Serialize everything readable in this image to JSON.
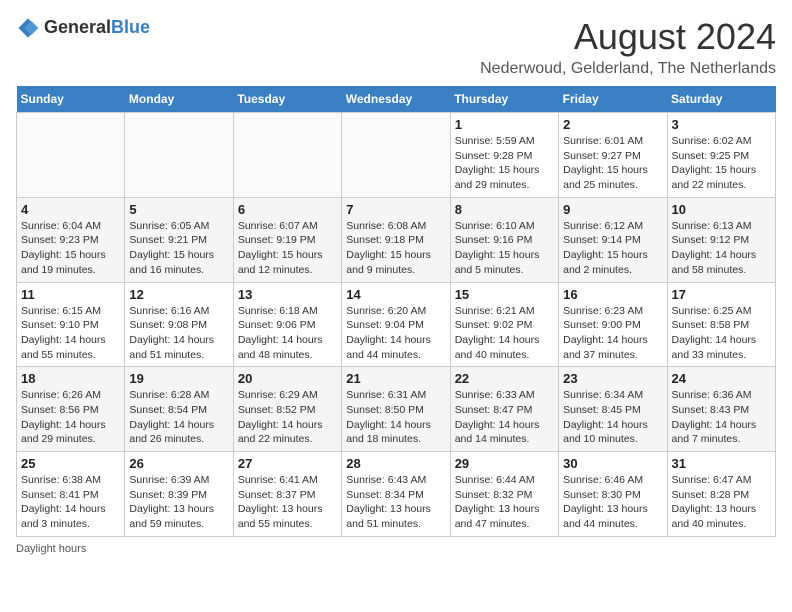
{
  "header": {
    "logo_general": "General",
    "logo_blue": "Blue",
    "title": "August 2024",
    "subtitle": "Nederwoud, Gelderland, The Netherlands"
  },
  "days_of_week": [
    "Sunday",
    "Monday",
    "Tuesday",
    "Wednesday",
    "Thursday",
    "Friday",
    "Saturday"
  ],
  "weeks": [
    [
      {
        "day": "",
        "info": ""
      },
      {
        "day": "",
        "info": ""
      },
      {
        "day": "",
        "info": ""
      },
      {
        "day": "",
        "info": ""
      },
      {
        "day": "1",
        "info": "Sunrise: 5:59 AM\nSunset: 9:28 PM\nDaylight: 15 hours and 29 minutes."
      },
      {
        "day": "2",
        "info": "Sunrise: 6:01 AM\nSunset: 9:27 PM\nDaylight: 15 hours and 25 minutes."
      },
      {
        "day": "3",
        "info": "Sunrise: 6:02 AM\nSunset: 9:25 PM\nDaylight: 15 hours and 22 minutes."
      }
    ],
    [
      {
        "day": "4",
        "info": "Sunrise: 6:04 AM\nSunset: 9:23 PM\nDaylight: 15 hours and 19 minutes."
      },
      {
        "day": "5",
        "info": "Sunrise: 6:05 AM\nSunset: 9:21 PM\nDaylight: 15 hours and 16 minutes."
      },
      {
        "day": "6",
        "info": "Sunrise: 6:07 AM\nSunset: 9:19 PM\nDaylight: 15 hours and 12 minutes."
      },
      {
        "day": "7",
        "info": "Sunrise: 6:08 AM\nSunset: 9:18 PM\nDaylight: 15 hours and 9 minutes."
      },
      {
        "day": "8",
        "info": "Sunrise: 6:10 AM\nSunset: 9:16 PM\nDaylight: 15 hours and 5 minutes."
      },
      {
        "day": "9",
        "info": "Sunrise: 6:12 AM\nSunset: 9:14 PM\nDaylight: 15 hours and 2 minutes."
      },
      {
        "day": "10",
        "info": "Sunrise: 6:13 AM\nSunset: 9:12 PM\nDaylight: 14 hours and 58 minutes."
      }
    ],
    [
      {
        "day": "11",
        "info": "Sunrise: 6:15 AM\nSunset: 9:10 PM\nDaylight: 14 hours and 55 minutes."
      },
      {
        "day": "12",
        "info": "Sunrise: 6:16 AM\nSunset: 9:08 PM\nDaylight: 14 hours and 51 minutes."
      },
      {
        "day": "13",
        "info": "Sunrise: 6:18 AM\nSunset: 9:06 PM\nDaylight: 14 hours and 48 minutes."
      },
      {
        "day": "14",
        "info": "Sunrise: 6:20 AM\nSunset: 9:04 PM\nDaylight: 14 hours and 44 minutes."
      },
      {
        "day": "15",
        "info": "Sunrise: 6:21 AM\nSunset: 9:02 PM\nDaylight: 14 hours and 40 minutes."
      },
      {
        "day": "16",
        "info": "Sunrise: 6:23 AM\nSunset: 9:00 PM\nDaylight: 14 hours and 37 minutes."
      },
      {
        "day": "17",
        "info": "Sunrise: 6:25 AM\nSunset: 8:58 PM\nDaylight: 14 hours and 33 minutes."
      }
    ],
    [
      {
        "day": "18",
        "info": "Sunrise: 6:26 AM\nSunset: 8:56 PM\nDaylight: 14 hours and 29 minutes."
      },
      {
        "day": "19",
        "info": "Sunrise: 6:28 AM\nSunset: 8:54 PM\nDaylight: 14 hours and 26 minutes."
      },
      {
        "day": "20",
        "info": "Sunrise: 6:29 AM\nSunset: 8:52 PM\nDaylight: 14 hours and 22 minutes."
      },
      {
        "day": "21",
        "info": "Sunrise: 6:31 AM\nSunset: 8:50 PM\nDaylight: 14 hours and 18 minutes."
      },
      {
        "day": "22",
        "info": "Sunrise: 6:33 AM\nSunset: 8:47 PM\nDaylight: 14 hours and 14 minutes."
      },
      {
        "day": "23",
        "info": "Sunrise: 6:34 AM\nSunset: 8:45 PM\nDaylight: 14 hours and 10 minutes."
      },
      {
        "day": "24",
        "info": "Sunrise: 6:36 AM\nSunset: 8:43 PM\nDaylight: 14 hours and 7 minutes."
      }
    ],
    [
      {
        "day": "25",
        "info": "Sunrise: 6:38 AM\nSunset: 8:41 PM\nDaylight: 14 hours and 3 minutes."
      },
      {
        "day": "26",
        "info": "Sunrise: 6:39 AM\nSunset: 8:39 PM\nDaylight: 13 hours and 59 minutes."
      },
      {
        "day": "27",
        "info": "Sunrise: 6:41 AM\nSunset: 8:37 PM\nDaylight: 13 hours and 55 minutes."
      },
      {
        "day": "28",
        "info": "Sunrise: 6:43 AM\nSunset: 8:34 PM\nDaylight: 13 hours and 51 minutes."
      },
      {
        "day": "29",
        "info": "Sunrise: 6:44 AM\nSunset: 8:32 PM\nDaylight: 13 hours and 47 minutes."
      },
      {
        "day": "30",
        "info": "Sunrise: 6:46 AM\nSunset: 8:30 PM\nDaylight: 13 hours and 44 minutes."
      },
      {
        "day": "31",
        "info": "Sunrise: 6:47 AM\nSunset: 8:28 PM\nDaylight: 13 hours and 40 minutes."
      }
    ]
  ],
  "footer": {
    "daylight_label": "Daylight hours"
  }
}
